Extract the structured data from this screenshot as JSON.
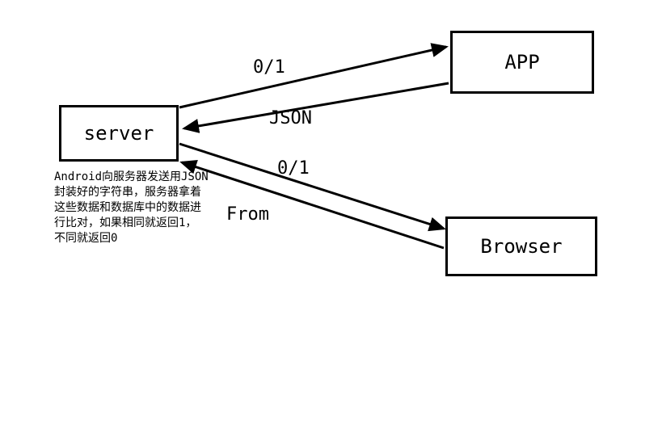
{
  "nodes": {
    "server": "server",
    "app": "APP",
    "browser": "Browser"
  },
  "edges": {
    "server_to_app": "0/1",
    "app_to_server": "JSON",
    "server_to_browser": "0/1",
    "browser_to_server": "From"
  },
  "description": "Android向服务器发送用JSON\n封装好的字符串，服务器拿着\n这些数据和数据库中的数据进\n行比对，如果相同就返回1，\n不同就返回0"
}
